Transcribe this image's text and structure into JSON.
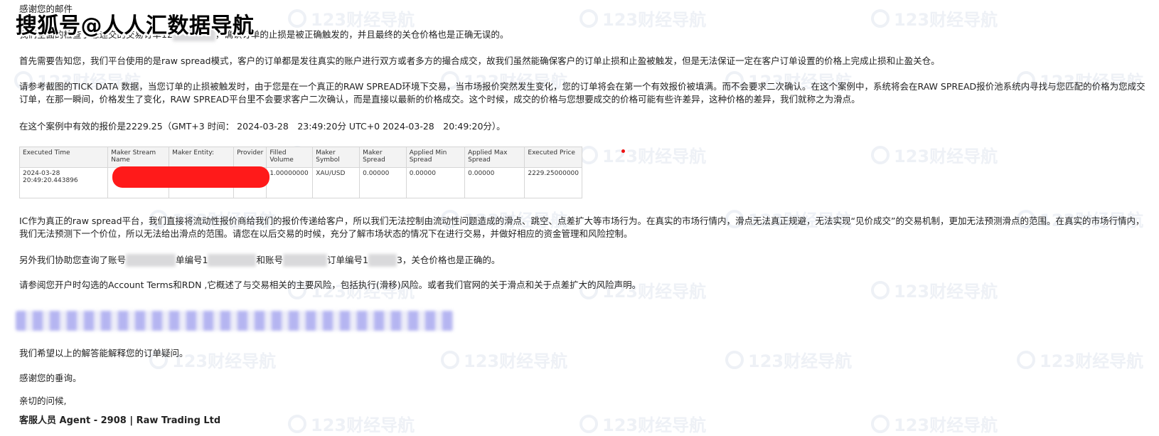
{
  "overlay_title": "搜狐号@人人汇数据导航",
  "watermark_text": "123财经导航",
  "email": {
    "greeting": "感谢您的邮件",
    "p1_prefix": "我们全面的检查了您递交的交易订单12",
    "p1_suffix": "，确认订单的止损是被正确触发的，并且最终的关仓价格也是正确无误的。",
    "p2": "首先需要告知您，我们平台使用的是raw spread模式，客户的订单都是发往真实的账户进行双方或者多方的撮合成交，故我们虽然能确保客户的订单止损和止盈被触发，但是无法保证一定在客户订单设置的价格上完成止损和止盈关仓。",
    "p3": "请参考截图的TICK DATA 数据，当您订单的止损被触发时，由于您是在一个真正的RAW SPREAD环境下交易，当市场报价突然发生变化，您的订单将会在第一个有效报价被填满。而不会要求二次确认。在这个案例中，系统将会在RAW SPREAD报价池系统内寻找与您匹配的价格为您成交订单，在那一瞬间，价格发生了变化，RAW SPREAD平台里不会要求客户二次确认，而是直接以最新的价格成交。这个时候，成交的价格与您想要成交的价格可能有些许差异，这种价格的差异，我们就称之为滑点。",
    "p4": "在这个案例中有效的报价是2229.25（GMT+3 时间： 2024-03-28　23:49:20分  UTC+0  2024-03-28　20:49:20分）。",
    "p5": "IC作为真正的raw spread平台，我们直接将流动性报价商给我们的报价传递给客户，所以我们无法控制由流动性问题造成的滑点、跳空、点差扩大等市场行为。在真实的市场行情内，滑点无法真正规避，无法实现“见价成交”的交易机制，更加无法预测滑点的范围。在真实的市场行情内，我们无法预测下一个价位，所以无法给出滑点的范围。请您在以后交易的时候，充分了解市场状态的情况下在进行交易，并做好相应的资金管理和风险控制。",
    "p6_a": "另外我们协助您查询了账号",
    "p6_b": "单编号1",
    "p6_c": "和账号",
    "p6_d": "订单编号1",
    "p6_e": "3，关仓价格也是正确的。",
    "p7": "请参阅您开户时勾选的Account Terms和RDN ,它概述了与交易相关的主要风险，包括执行(滑移)风险。或者我们官网的关于滑点和关于点差扩大的风险声明。",
    "p8": "我们希望以上的解答能解释您的订单疑问。",
    "p9": "感谢您的垂询。",
    "p10": "亲切的问候,",
    "signature": "客服人员 Agent - 2908 | Raw Trading Ltd"
  },
  "tick_table": {
    "headers": [
      "Executed Time",
      "Maker Stream Name",
      "Maker Entity:",
      "Provider",
      "Filled Volume",
      "Maker Symbol",
      "Maker Spread",
      "Applied Min Spread",
      "Applied Max Spread",
      "Executed Price"
    ],
    "row": {
      "executed_time": "2024-03-28 20:49:20.443896",
      "maker_stream_name": "",
      "maker_entity": "",
      "provider": "",
      "filled_volume": "1.00000000",
      "maker_symbol": "XAU/USD",
      "maker_spread": "0.00000",
      "applied_min_spread": "0.00000",
      "applied_max_spread": "0.00000",
      "executed_price": "2229.25000000"
    }
  },
  "colors": {
    "redaction": "#ff1a1a",
    "text": "#222222",
    "link_blur": "#7878e6"
  }
}
